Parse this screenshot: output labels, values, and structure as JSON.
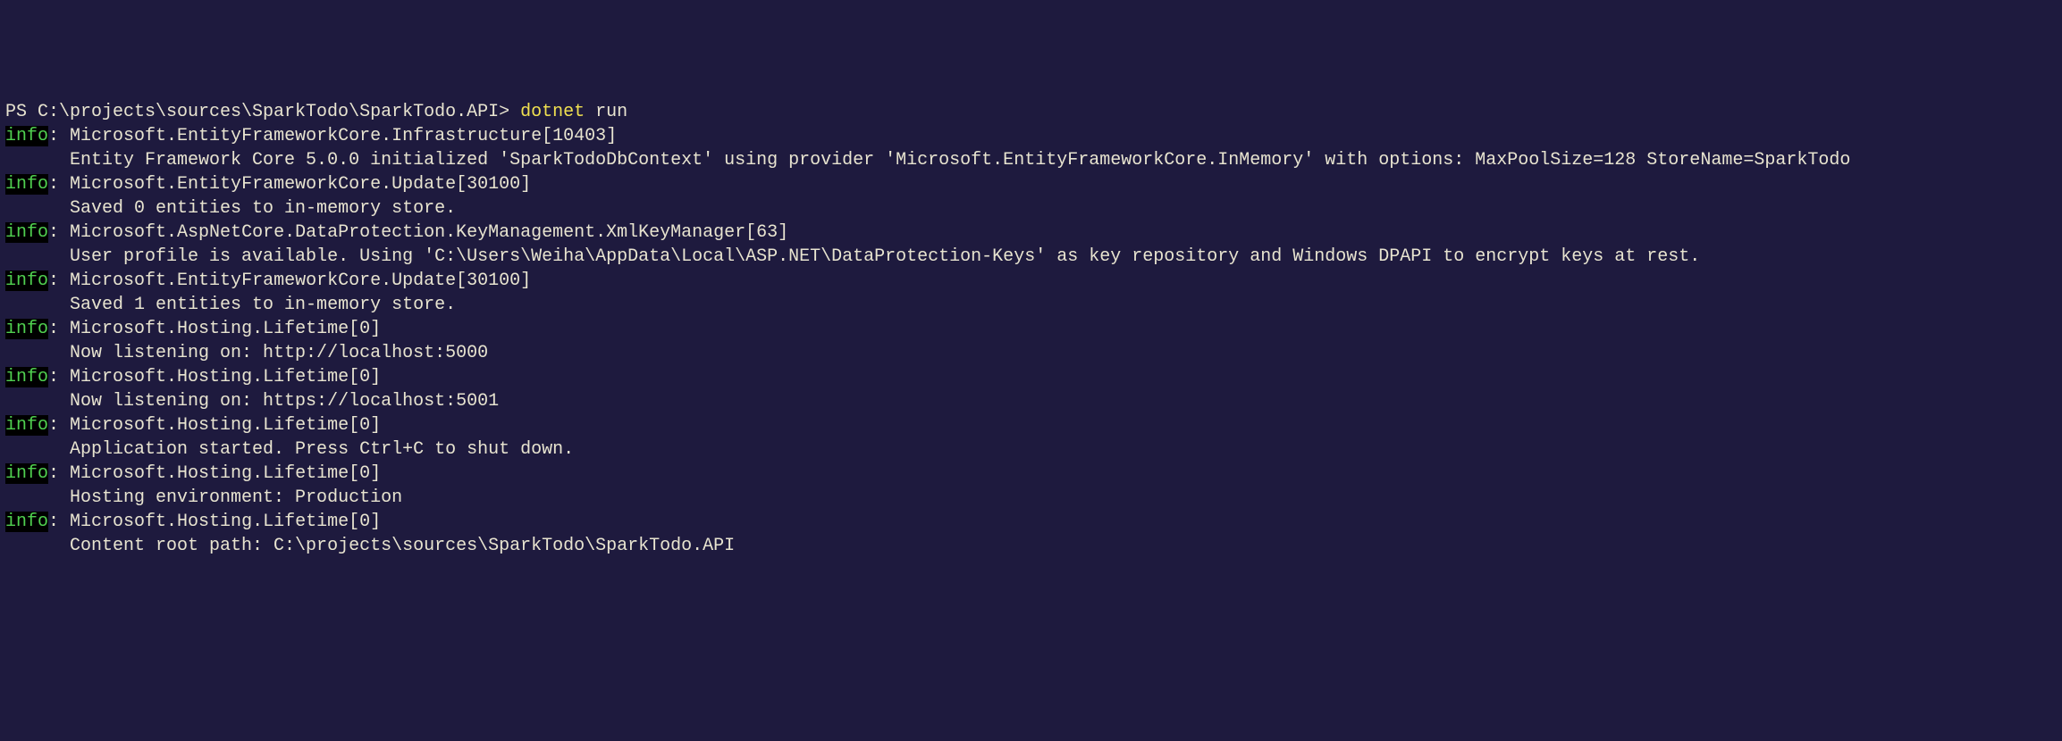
{
  "prompt": {
    "prefix": "PS C:\\projects\\sources\\SparkTodo\\SparkTodo.API> ",
    "command": "dotnet",
    "arg": " run"
  },
  "info_label": "info",
  "colon_sep": ": ",
  "logs": [
    {
      "source": "Microsoft.EntityFrameworkCore.Infrastructure[10403]",
      "message": "      Entity Framework Core 5.0.0 initialized 'SparkTodoDbContext' using provider 'Microsoft.EntityFrameworkCore.InMemory' with options: MaxPoolSize=128 StoreName=SparkTodo"
    },
    {
      "source": "Microsoft.EntityFrameworkCore.Update[30100]",
      "message": "      Saved 0 entities to in-memory store."
    },
    {
      "source": "Microsoft.AspNetCore.DataProtection.KeyManagement.XmlKeyManager[63]",
      "message": "      User profile is available. Using 'C:\\Users\\Weiha\\AppData\\Local\\ASP.NET\\DataProtection-Keys' as key repository and Windows DPAPI to encrypt keys at rest."
    },
    {
      "source": "Microsoft.EntityFrameworkCore.Update[30100]",
      "message": "      Saved 1 entities to in-memory store."
    },
    {
      "source": "Microsoft.Hosting.Lifetime[0]",
      "message": "      Now listening on: http://localhost:5000"
    },
    {
      "source": "Microsoft.Hosting.Lifetime[0]",
      "message": "      Now listening on: https://localhost:5001"
    },
    {
      "source": "Microsoft.Hosting.Lifetime[0]",
      "message": "      Application started. Press Ctrl+C to shut down."
    },
    {
      "source": "Microsoft.Hosting.Lifetime[0]",
      "message": "      Hosting environment: Production"
    },
    {
      "source": "Microsoft.Hosting.Lifetime[0]",
      "message": "      Content root path: C:\\projects\\sources\\SparkTodo\\SparkTodo.API"
    }
  ]
}
